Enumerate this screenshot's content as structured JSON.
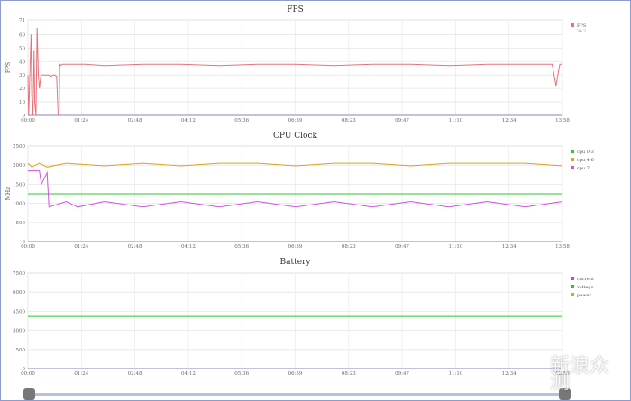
{
  "time_ticks": [
    "00:00",
    "01:24",
    "02:48",
    "04:12",
    "05:36",
    "06:59",
    "08:23",
    "09:47",
    "11:10",
    "12:34",
    "13:58"
  ],
  "chart_data": [
    {
      "type": "line",
      "title": "FPS",
      "ylabel": "FPS",
      "ylim": [
        0,
        71
      ],
      "yticks": [
        0,
        10,
        20,
        30,
        40,
        50,
        60,
        71
      ],
      "grid": true,
      "legend": "top-right",
      "series": [
        {
          "name": "FPS",
          "sublabel": "36.2",
          "color": "#e8707a",
          "x": [
            0,
            0.02,
            0.05,
            0.08,
            0.1,
            0.13,
            0.16,
            0.18,
            0.21,
            0.24,
            0.27,
            0.3,
            0.34,
            0.38,
            0.42,
            0.46,
            0.5,
            0.55,
            0.6,
            0.65,
            0.7,
            0.75,
            0.79,
            0.8,
            0.81,
            0.82,
            0.83,
            0.85,
            0.9,
            1.0,
            1.5,
            2.0,
            3.0,
            4.0,
            5.0,
            6.0,
            7.0,
            8.0,
            9.0,
            10.0,
            11.0,
            12.0,
            13.0,
            13.5,
            13.7,
            13.8,
            13.85,
            13.9,
            13.97
          ],
          "values": [
            30,
            0,
            30,
            60,
            15,
            0,
            48,
            10,
            0,
            65,
            30,
            20,
            30,
            30,
            30,
            30,
            30,
            30,
            29,
            30,
            30,
            29,
            0,
            0,
            0,
            10,
            38,
            37,
            38,
            38,
            38,
            37,
            38,
            38,
            37,
            38,
            38,
            37,
            38,
            38,
            37,
            38,
            38,
            38,
            38,
            22,
            30,
            38,
            38
          ]
        }
      ]
    },
    {
      "type": "line",
      "title": "CPU Clock",
      "ylabel": "MHz",
      "ylim": [
        0,
        2500
      ],
      "yticks": [
        0,
        500,
        1000,
        1500,
        2000,
        2500
      ],
      "grid": true,
      "legend": "top-right",
      "series": [
        {
          "name": "cpu 0-3",
          "color": "#2fc62f",
          "x": [
            0,
            13.97
          ],
          "values": [
            1250,
            1250
          ]
        },
        {
          "name": "cpu 4-6",
          "color": "#e0a020",
          "x": [
            0,
            0.1,
            0.3,
            0.5,
            1.0,
            2.0,
            3.0,
            4.0,
            5.0,
            6.0,
            7.0,
            8.0,
            9.0,
            10.0,
            11.0,
            12.0,
            13.0,
            13.97
          ],
          "values": [
            2050,
            1950,
            2050,
            1950,
            2050,
            1980,
            2050,
            1980,
            2050,
            2050,
            1980,
            2050,
            2050,
            1980,
            2050,
            2050,
            2050,
            1980
          ]
        },
        {
          "name": "cpu 7",
          "color": "#cc55dd",
          "x": [
            0,
            0.3,
            0.35,
            0.5,
            0.55,
            1.0,
            1.3,
            2.0,
            3.0,
            4.0,
            5.0,
            6.0,
            7.0,
            8.0,
            9.0,
            10.0,
            11.0,
            12.0,
            13.0,
            13.97
          ],
          "values": [
            1850,
            1850,
            1500,
            1800,
            900,
            1050,
            900,
            1050,
            900,
            1050,
            900,
            1050,
            900,
            1050,
            900,
            1050,
            900,
            1050,
            900,
            1050
          ]
        }
      ]
    },
    {
      "type": "line",
      "title": "Battery",
      "ylim": [
        0,
        7500
      ],
      "yticks": [
        0,
        1500,
        3000,
        4500,
        6000,
        7500
      ],
      "grid": true,
      "legend": "top-right",
      "series": [
        {
          "name": "current",
          "color": "#cc44cc",
          "x": [],
          "values": []
        },
        {
          "name": "voltage",
          "color": "#2fc62f",
          "x": [
            0,
            13.97
          ],
          "values": [
            4100,
            4100
          ]
        },
        {
          "name": "power",
          "color": "#e0a020",
          "x": [],
          "values": []
        }
      ]
    }
  ],
  "watermark": "新浪众测"
}
